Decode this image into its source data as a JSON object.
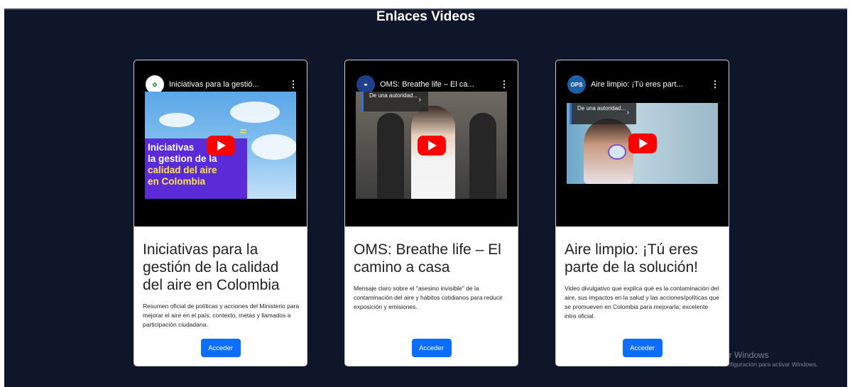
{
  "page": {
    "title": "Enlaces Videos"
  },
  "cards": [
    {
      "video": {
        "title": "Iniciativas para la gestió...",
        "thumbnail_text": {
          "line1": "Iniciativas",
          "line2": "la gestion de la",
          "line3": "calidad del aire",
          "line4": "en Colombia"
        }
      },
      "title": "Iniciativas para la gestión de la calidad del aire en Colombia",
      "description": "Resumen oficial de políticas y acciones del Ministerio para mejorar el aire en el país: contexto, metas y llamados a participación ciudadana.",
      "button_label": "Acceder"
    },
    {
      "video": {
        "title": "OMS: Breathe life – El ca...",
        "chip_text": "De una autoridad..."
      },
      "title": "OMS: Breathe life – El camino a casa",
      "description": "Mensaje claro sobre el \"asesino invisible\" de la contaminación del aire y hábitos cotidianos para reducir exposición y emisiones.",
      "button_label": "Acceder"
    },
    {
      "video": {
        "title": "Aire limpio: ¡Tú eres part...",
        "channel_badge": "OPS",
        "chip_text": "De una autoridad..."
      },
      "title": "Aire limpio: ¡Tú eres parte de la solución!",
      "description": "Video divulgativo que explica qué es la contaminación del aire, sus impactos en la salud y las acciones/políticas que se promueven en Colombia para mejorarla; excelente intro oficial.",
      "button_label": "Acceder"
    }
  ],
  "watermark": {
    "line1": "Activar Windows",
    "line2": "Ve a Configuración para activar Windows."
  },
  "colors": {
    "background": "#0f1629",
    "button": "#0d6efd",
    "youtube_red": "#ff0000"
  }
}
